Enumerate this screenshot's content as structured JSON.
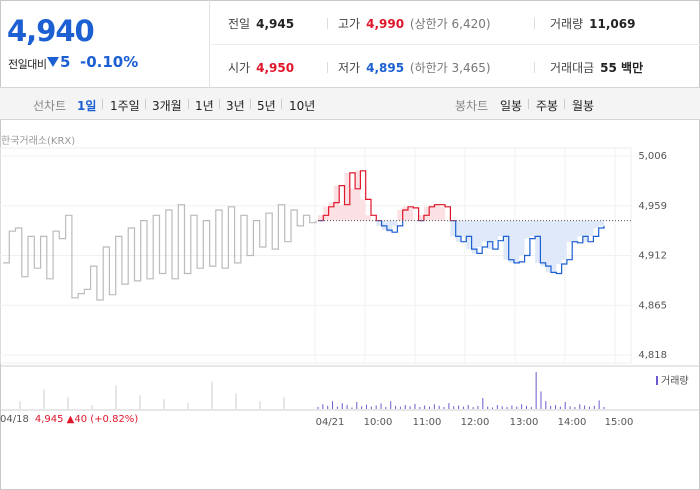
{
  "quote": {
    "price": "4,940",
    "change_label": "전일대비",
    "change_value": "5",
    "change_rate": "-0.10%",
    "stats": {
      "prev_close": {
        "label": "전일",
        "value": "4,945"
      },
      "high": {
        "label": "고가",
        "value": "4,990",
        "sub": "(상한가 6,420)"
      },
      "volume": {
        "label": "거래량",
        "value": "11,069"
      },
      "open": {
        "label": "시가",
        "value": "4,950"
      },
      "low": {
        "label": "저가",
        "value": "4,895",
        "sub": "(하한가 3,465)"
      },
      "amount": {
        "label": "거래대금",
        "value": "55 백만"
      }
    }
  },
  "tabs": {
    "line_label": "선차트",
    "line": [
      "1일",
      "1주일",
      "3개월",
      "1년",
      "3년",
      "5년",
      "10년"
    ],
    "candle_label": "봉차트",
    "candle": [
      "일봉",
      "주봉",
      "월봉"
    ]
  },
  "exchange": "한국거래소(KRX)",
  "colors": {
    "up": "#e0162b",
    "down": "#1b5fd3",
    "prev_series": "#bbbbbb",
    "volume": "#6a5acd"
  },
  "chart_data": {
    "type": "line",
    "y_ticks": [
      "5,006",
      "4,959",
      "4,912",
      "4,865",
      "4,818"
    ],
    "ylim": [
      4818,
      5006
    ],
    "reference_line": 4945,
    "x_ticks": [
      "04/21",
      "10:00",
      "11:00",
      "12:00",
      "13:00",
      "14:00",
      "15:00"
    ],
    "volume_legend": "거래량",
    "previous_day": {
      "date": "04/18",
      "close": "4,945",
      "change": "▲40",
      "rate": "(+0.82%)",
      "values": [
        4905,
        4935,
        4938,
        4892,
        4930,
        4900,
        4930,
        4890,
        4935,
        4928,
        4950,
        4872,
        4876,
        4880,
        4902,
        4870,
        4920,
        4875,
        4930,
        4885,
        4938,
        4888,
        4945,
        4890,
        4950,
        4895,
        4955,
        4890,
        4960,
        4895,
        4950,
        4900,
        4945,
        4902,
        4955,
        4900,
        4958,
        4905,
        4950,
        4912,
        4945,
        4920,
        4952,
        4918,
        4960,
        4925,
        4955,
        4940,
        4950,
        4943,
        4945
      ]
    },
    "today_values": [
      4945,
      4950,
      4958,
      4962,
      4978,
      4960,
      4990,
      4975,
      4992,
      4965,
      4950,
      4945,
      4940,
      4936,
      4934,
      4940,
      4955,
      4958,
      4957,
      4945,
      4950,
      4958,
      4960,
      4960,
      4958,
      4945,
      4930,
      4925,
      4930,
      4918,
      4914,
      4920,
      4925,
      4918,
      4926,
      4930,
      4908,
      4905,
      4906,
      4912,
      4928,
      4930,
      4905,
      4902,
      4896,
      4895,
      4904,
      4908,
      4925,
      4924,
      4930,
      4925,
      4930,
      4938,
      4940
    ],
    "volumes": [
      0.05,
      0.12,
      0.08,
      0.2,
      0.06,
      0.15,
      0.1,
      0.04,
      0.18,
      0.07,
      0.11,
      0.06,
      0.09,
      0.14,
      0.05,
      0.2,
      0.08,
      0.06,
      0.1,
      0.07,
      0.13,
      0.05,
      0.09,
      0.06,
      0.12,
      0.08,
      0.05,
      0.15,
      0.07,
      0.09,
      0.06,
      0.1,
      0.05,
      0.08,
      0.28,
      0.06,
      0.04,
      0.1,
      0.07,
      0.05,
      0.09,
      0.06,
      0.12,
      0.08,
      0.05,
      0.95,
      0.45,
      0.2,
      0.08,
      0.1,
      0.06,
      0.18,
      0.07,
      0.05,
      0.12,
      0.09,
      0.06,
      0.08,
      0.22,
      0.05
    ]
  }
}
